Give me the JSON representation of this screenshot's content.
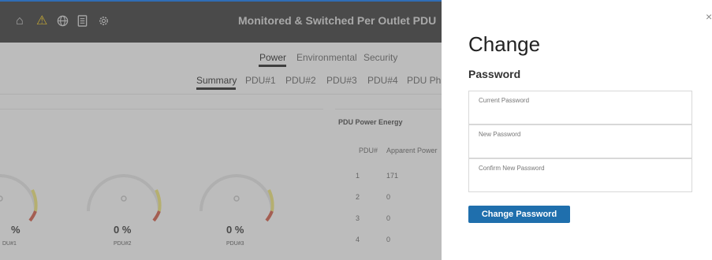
{
  "header": {
    "title": "Monitored & Switched Per Outlet PDU",
    "icons": [
      "home-icon",
      "warning-icon",
      "globe-icon",
      "document-icon",
      "settings-icon"
    ]
  },
  "nav": {
    "primary_tabs": [
      "Power",
      "Environmental",
      "Security"
    ],
    "secondary_tabs": [
      "Summary",
      "PDU#1",
      "PDU#2",
      "PDU#3",
      "PDU#4",
      "PDU Ph"
    ]
  },
  "gauges": [
    {
      "value": "%",
      "label": "DU#1",
      "level": 0.9
    },
    {
      "value": "0 %",
      "label": "PDU#2",
      "level": 0
    },
    {
      "value": "0 %",
      "label": "PDU#3",
      "level": 0
    }
  ],
  "energy_panel": {
    "title": "PDU Power Energy",
    "columns": [
      "PDU#",
      "Apparent Power"
    ],
    "rows": [
      [
        "1",
        "171"
      ],
      [
        "2",
        "0"
      ],
      [
        "3",
        "0"
      ],
      [
        "4",
        "0"
      ]
    ]
  },
  "modal": {
    "title": "Change",
    "subtitle": "Password",
    "close_glyph": "×",
    "fields": [
      {
        "label": "Current Password",
        "value": ""
      },
      {
        "label": "New Password",
        "value": ""
      },
      {
        "label": "Confirm New Password",
        "value": ""
      }
    ],
    "submit_label": "Change Password"
  },
  "colors": {
    "topbar": "#262626",
    "accent_blue": "#1f6fad",
    "warning_yellow": "#f3c300",
    "gauge_yellow": "#e8dc6a",
    "gauge_red": "#c84a33"
  }
}
